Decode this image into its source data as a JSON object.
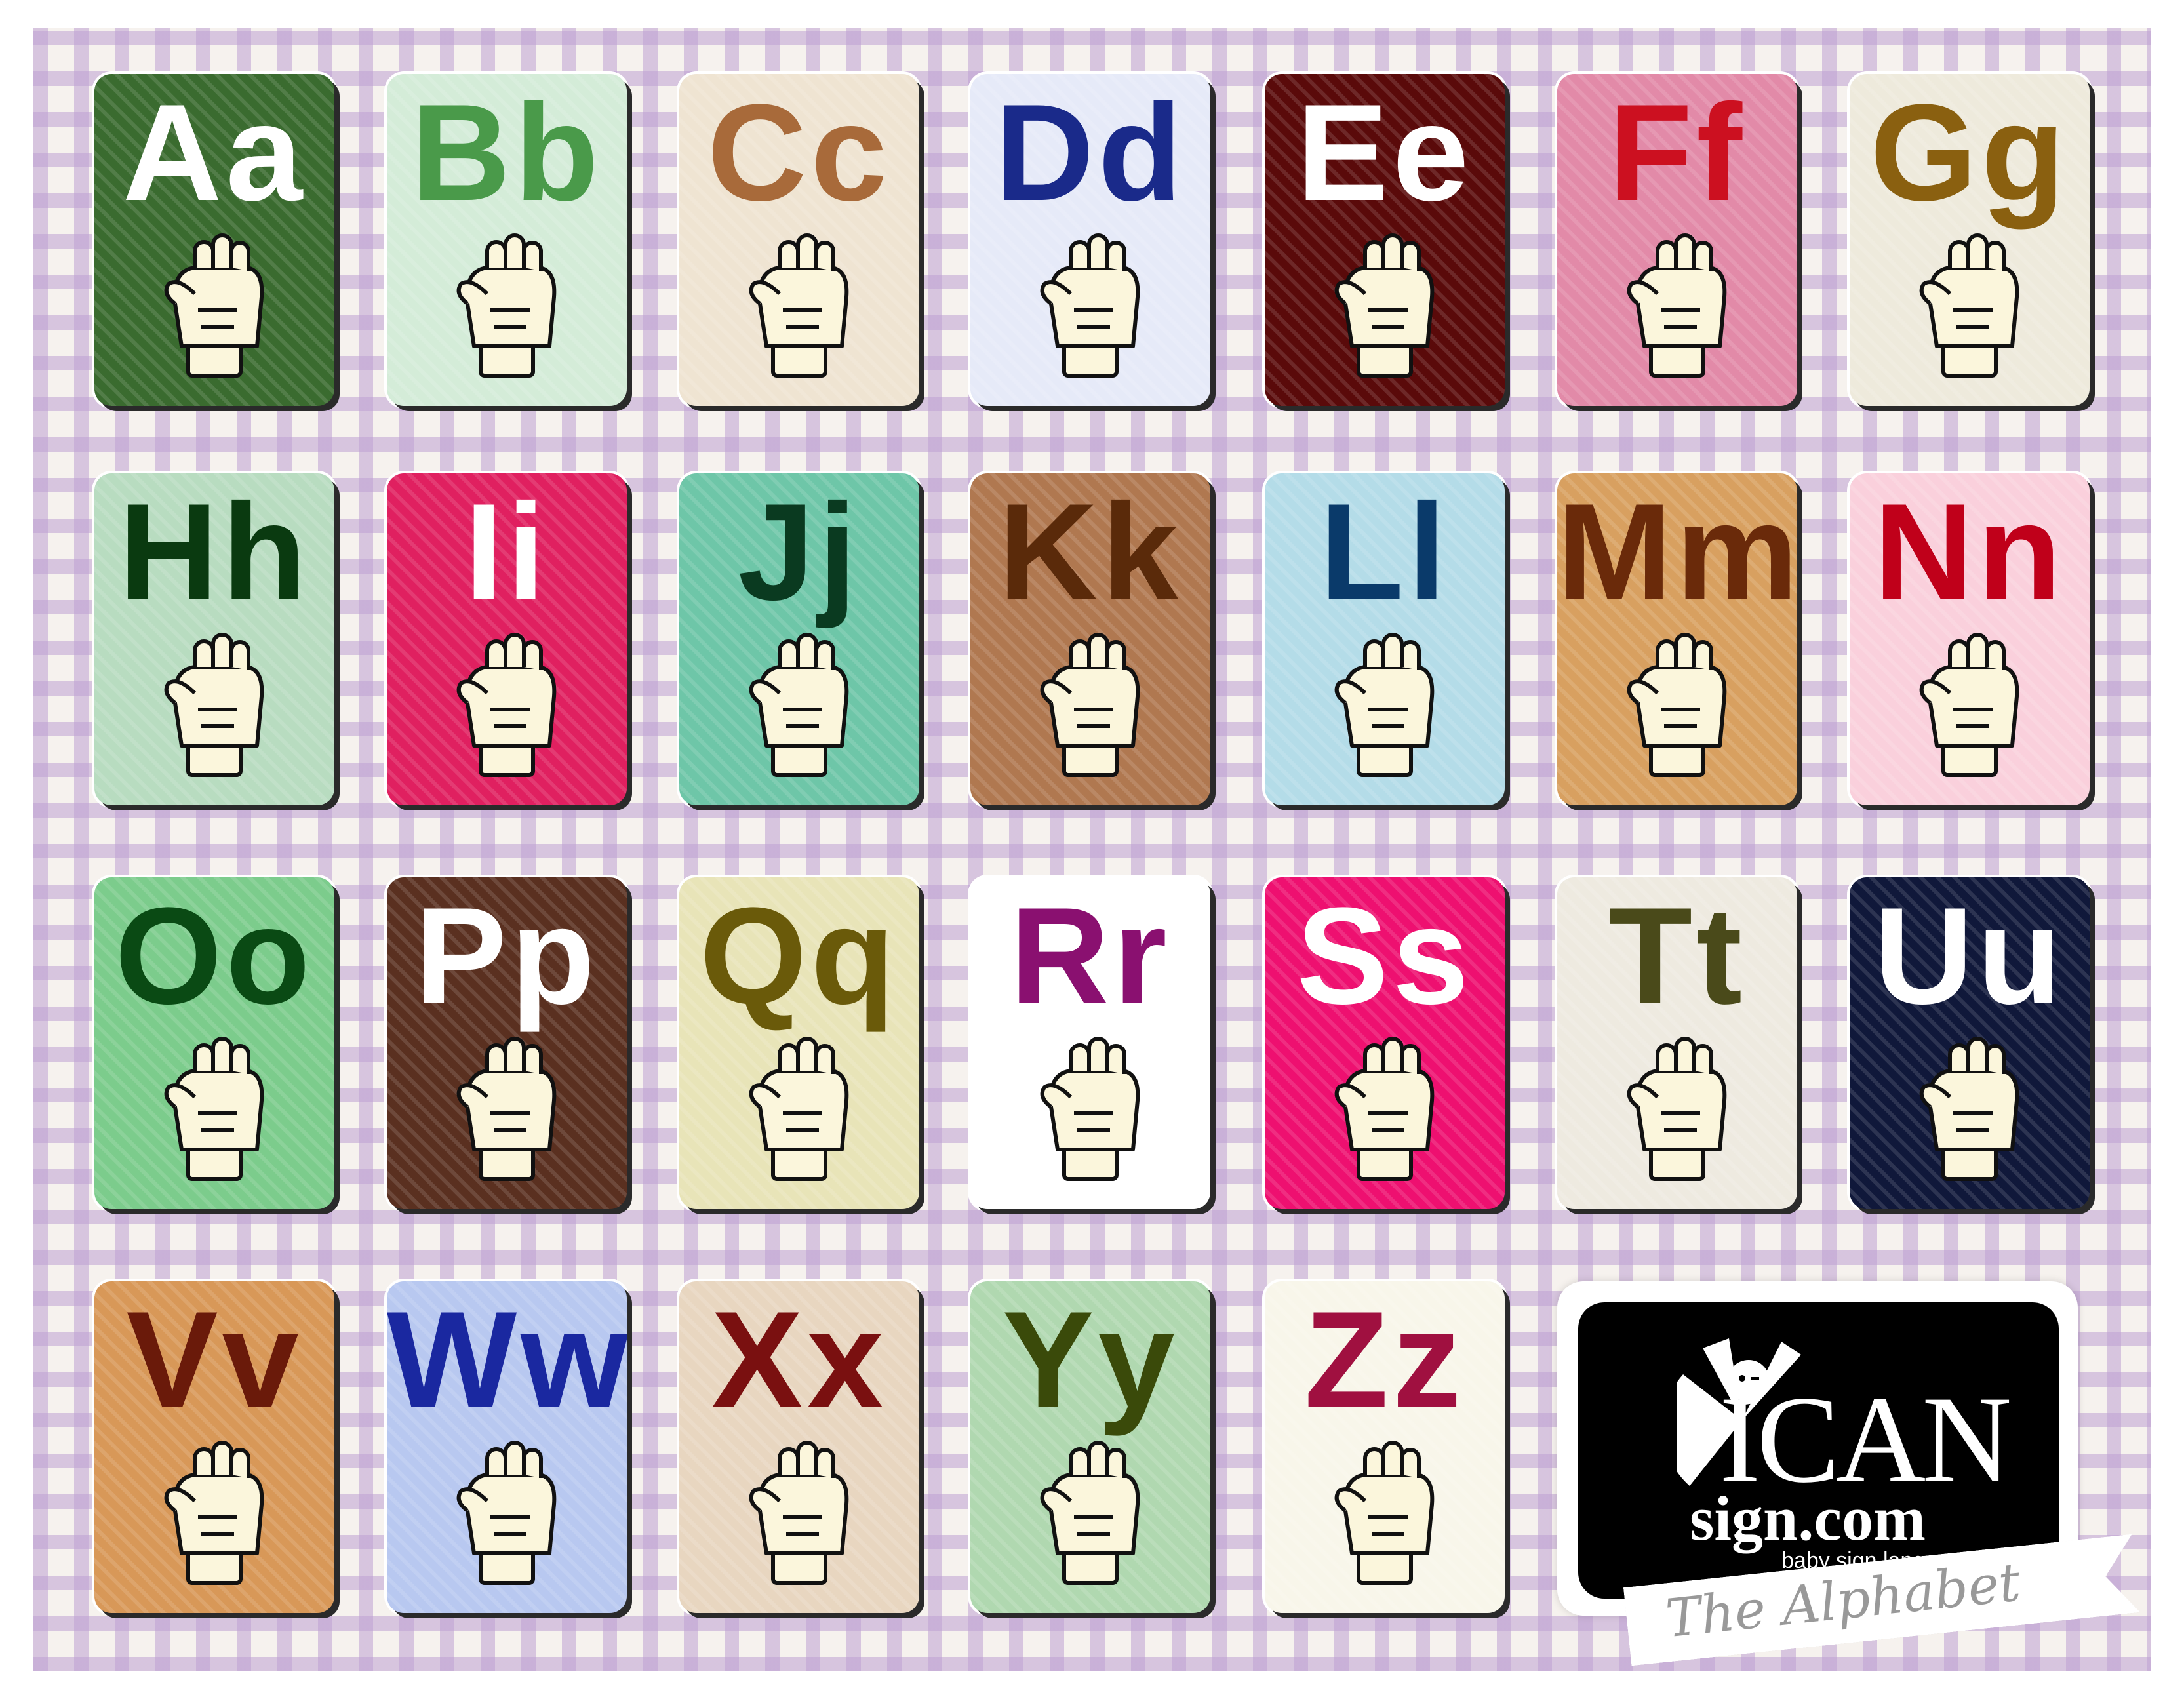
{
  "title_banner": "The Alphabet",
  "logo": {
    "brand": "ICAN",
    "domain": "sign.com",
    "tagline": "baby sign language"
  },
  "cards": [
    {
      "label": "Aa",
      "bg": "#3a6b2f",
      "fg": "#ffffff"
    },
    {
      "label": "Bb",
      "bg": "#d4ecd8",
      "fg": "#4a9a4a"
    },
    {
      "label": "Cc",
      "bg": "#efe4d2",
      "fg": "#a86a3a"
    },
    {
      "label": "Dd",
      "bg": "#e6eaf8",
      "fg": "#1a2a8a"
    },
    {
      "label": "Ee",
      "bg": "#5a0a0a",
      "fg": "#ffffff"
    },
    {
      "label": "Ff",
      "bg": "#e28aa8",
      "fg": "#cc1020"
    },
    {
      "label": "Gg",
      "bg": "#eeeadc",
      "fg": "#8a6010"
    },
    {
      "label": "Hh",
      "bg": "#b8dcc0",
      "fg": "#0a3a10"
    },
    {
      "label": "Ii",
      "bg": "#e02060",
      "fg": "#ffffff"
    },
    {
      "label": "Jj",
      "bg": "#6ec6a8",
      "fg": "#0a3a20"
    },
    {
      "label": "Kk",
      "bg": "#b07850",
      "fg": "#5a2a0a"
    },
    {
      "label": "Ll",
      "bg": "#b4dce8",
      "fg": "#0a3a6a"
    },
    {
      "label": "Mm",
      "bg": "#d8a060",
      "fg": "#6a2a0a"
    },
    {
      "label": "Nn",
      "bg": "#fad0dc",
      "fg": "#c0001a"
    },
    {
      "label": "Oo",
      "bg": "#7ccc8c",
      "fg": "#0a4a14"
    },
    {
      "label": "Pp",
      "bg": "#5a3020",
      "fg": "#ffffff"
    },
    {
      "label": "Qq",
      "bg": "#e8e4b8",
      "fg": "#6a5a0a"
    },
    {
      "label": "Rr",
      "bg": "#ffffff",
      "fg": "#8a1070"
    },
    {
      "label": "Ss",
      "bg": "#ee1070",
      "fg": "#ffffff"
    },
    {
      "label": "Tt",
      "bg": "#eeeae0",
      "fg": "#4a4a1a"
    },
    {
      "label": "Uu",
      "bg": "#10183a",
      "fg": "#ffffff"
    },
    {
      "label": "Vv",
      "bg": "#d89858",
      "fg": "#6a1a0a"
    },
    {
      "label": "Ww",
      "bg": "#b8c8f0",
      "fg": "#1a28a0"
    },
    {
      "label": "Xx",
      "bg": "#e8d6c0",
      "fg": "#7a1010"
    },
    {
      "label": "Yy",
      "bg": "#b0d8b0",
      "fg": "#3a4a0a"
    },
    {
      "label": "Zz",
      "bg": "#f8f6ea",
      "fg": "#a01040"
    }
  ]
}
